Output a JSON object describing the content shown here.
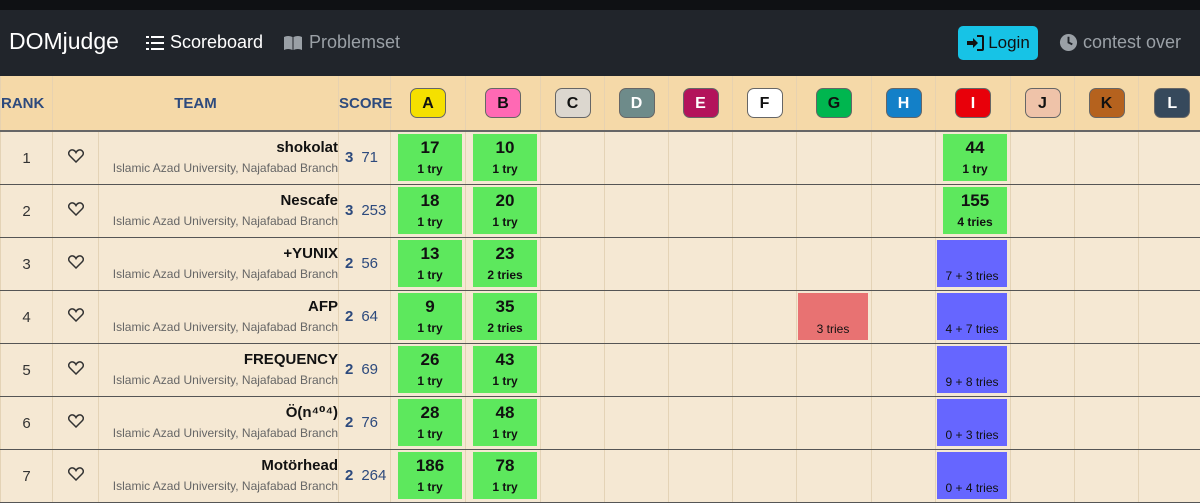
{
  "nav": {
    "brand": "DOMjudge",
    "scoreboard": "Scoreboard",
    "problemset": "Problemset",
    "login": "Login",
    "status": "contest over"
  },
  "table": {
    "rank_header": "RANK",
    "team_header": "TEAM",
    "score_header": "SCORE"
  },
  "problems": [
    {
      "label": "A",
      "color": "#f5e000",
      "text": "#111"
    },
    {
      "label": "B",
      "color": "#ff69b4",
      "text": "#111"
    },
    {
      "label": "C",
      "color": "#dcd7cf",
      "text": "#111"
    },
    {
      "label": "D",
      "color": "#6e8b8a",
      "text": "#fff"
    },
    {
      "label": "E",
      "color": "#b3135b",
      "text": "#fff"
    },
    {
      "label": "F",
      "color": "#ffffff",
      "text": "#111"
    },
    {
      "label": "G",
      "color": "#00b64f",
      "text": "#111"
    },
    {
      "label": "H",
      "color": "#1380c8",
      "text": "#fff"
    },
    {
      "label": "I",
      "color": "#e8000a",
      "text": "#fff"
    },
    {
      "label": "J",
      "color": "#efc3a9",
      "text": "#111"
    },
    {
      "label": "K",
      "color": "#b5621e",
      "text": "#111"
    },
    {
      "label": "L",
      "color": "#36495c",
      "text": "#fff"
    }
  ],
  "rows": [
    {
      "rank": "1",
      "name": "shokolat",
      "affiliation": "Islamic Azad University, Najafabad Branch",
      "solved": "3",
      "penalty": "71",
      "cells": [
        {
          "s": "solved",
          "time": "17",
          "tries": "1 try"
        },
        {
          "s": "solved",
          "time": "10",
          "tries": "1 try"
        },
        {},
        {},
        {},
        {},
        {},
        {},
        {
          "s": "solved",
          "time": "44",
          "tries": "1 try"
        },
        {},
        {},
        {}
      ]
    },
    {
      "rank": "2",
      "name": "Nescafe",
      "affiliation": "Islamic Azad University, Najafabad Branch",
      "solved": "3",
      "penalty": "253",
      "cells": [
        {
          "s": "solved",
          "time": "18",
          "tries": "1 try"
        },
        {
          "s": "solved",
          "time": "20",
          "tries": "1 try"
        },
        {},
        {},
        {},
        {},
        {},
        {},
        {
          "s": "solved",
          "time": "155",
          "tries": "4 tries"
        },
        {},
        {},
        {}
      ]
    },
    {
      "rank": "3",
      "name": "+YUNIX",
      "affiliation": "Islamic Azad University, Najafabad Branch",
      "solved": "2",
      "penalty": "56",
      "cells": [
        {
          "s": "solved",
          "time": "13",
          "tries": "1 try"
        },
        {
          "s": "solved",
          "time": "23",
          "tries": "2 tries"
        },
        {},
        {},
        {},
        {},
        {},
        {},
        {
          "s": "pending",
          "tries": "7 + 3 tries"
        },
        {},
        {},
        {}
      ]
    },
    {
      "rank": "4",
      "name": "AFP",
      "affiliation": "Islamic Azad University, Najafabad Branch",
      "solved": "2",
      "penalty": "64",
      "cells": [
        {
          "s": "solved",
          "time": "9",
          "tries": "1 try"
        },
        {
          "s": "solved",
          "time": "35",
          "tries": "2 tries"
        },
        {},
        {},
        {},
        {},
        {
          "s": "wrong",
          "tries": "3 tries"
        },
        {},
        {
          "s": "pending",
          "tries": "4 + 7 tries"
        },
        {},
        {},
        {}
      ]
    },
    {
      "rank": "5",
      "name": "FREQUENCY",
      "affiliation": "Islamic Azad University, Najafabad Branch",
      "solved": "2",
      "penalty": "69",
      "cells": [
        {
          "s": "solved",
          "time": "26",
          "tries": "1 try"
        },
        {
          "s": "solved",
          "time": "43",
          "tries": "1 try"
        },
        {},
        {},
        {},
        {},
        {},
        {},
        {
          "s": "pending",
          "tries": "9 + 8 tries"
        },
        {},
        {},
        {}
      ]
    },
    {
      "rank": "6",
      "name": "Ö(n⁴⁰⁴)",
      "affiliation": "Islamic Azad University, Najafabad Branch",
      "solved": "2",
      "penalty": "76",
      "cells": [
        {
          "s": "solved",
          "time": "28",
          "tries": "1 try"
        },
        {
          "s": "solved",
          "time": "48",
          "tries": "1 try"
        },
        {},
        {},
        {},
        {},
        {},
        {},
        {
          "s": "pending",
          "tries": "0 + 3 tries"
        },
        {},
        {},
        {}
      ]
    },
    {
      "rank": "7",
      "name": "Motörhead",
      "affiliation": "Islamic Azad University, Najafabad Branch",
      "solved": "2",
      "penalty": "264",
      "cells": [
        {
          "s": "solved",
          "time": "186",
          "tries": "1 try"
        },
        {
          "s": "solved",
          "time": "78",
          "tries": "1 try"
        },
        {},
        {},
        {},
        {},
        {},
        {},
        {
          "s": "pending",
          "tries": "0 + 4 tries"
        },
        {},
        {},
        {}
      ]
    }
  ]
}
